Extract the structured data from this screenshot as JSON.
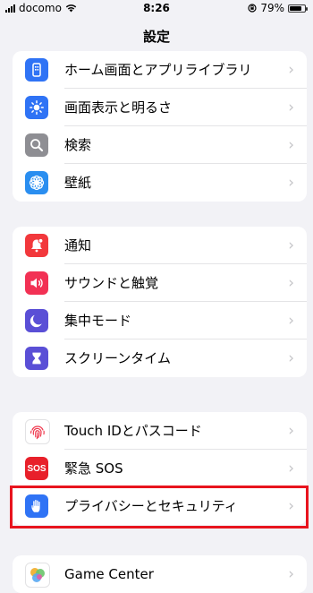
{
  "status_bar": {
    "carrier": "docomo",
    "time": "8:26",
    "battery_text": "79%",
    "battery_level": 0.79
  },
  "nav": {
    "title": "設定"
  },
  "groups": [
    {
      "rows": [
        {
          "label": "ホーム画面とアプリライブラリ",
          "icon": "home-screen-icon",
          "color": "#2f73f5"
        },
        {
          "label": "画面表示と明るさ",
          "icon": "brightness-icon",
          "color": "#2f73f5"
        },
        {
          "label": "検索",
          "icon": "search-icon",
          "color": "#8e8e93"
        },
        {
          "label": "壁紙",
          "icon": "wallpaper-icon",
          "color": "#2a8ef0"
        }
      ]
    },
    {
      "rows": [
        {
          "label": "通知",
          "icon": "notifications-icon",
          "color": "#f2383c"
        },
        {
          "label": "サウンドと触覚",
          "icon": "sound-icon",
          "color": "#f23154"
        },
        {
          "label": "集中モード",
          "icon": "moon-icon",
          "color": "#5a4fd6"
        },
        {
          "label": "スクリーンタイム",
          "icon": "hourglass-icon",
          "color": "#5a4fd6"
        }
      ]
    },
    {
      "rows": [
        {
          "label": "Touch IDとパスコード",
          "icon": "fingerprint-icon",
          "color": "#ffffff"
        },
        {
          "label": "緊急 SOS",
          "icon": "sos-icon",
          "color": "#e8202a",
          "icon_text": "SOS"
        },
        {
          "label": "プライバシーとセキュリティ",
          "icon": "hand-icon",
          "color": "#2f73f5"
        }
      ]
    },
    {
      "rows": [
        {
          "label": "Game Center",
          "icon": "game-center-icon",
          "color": "#ffffff"
        }
      ]
    }
  ],
  "chevron": "›"
}
